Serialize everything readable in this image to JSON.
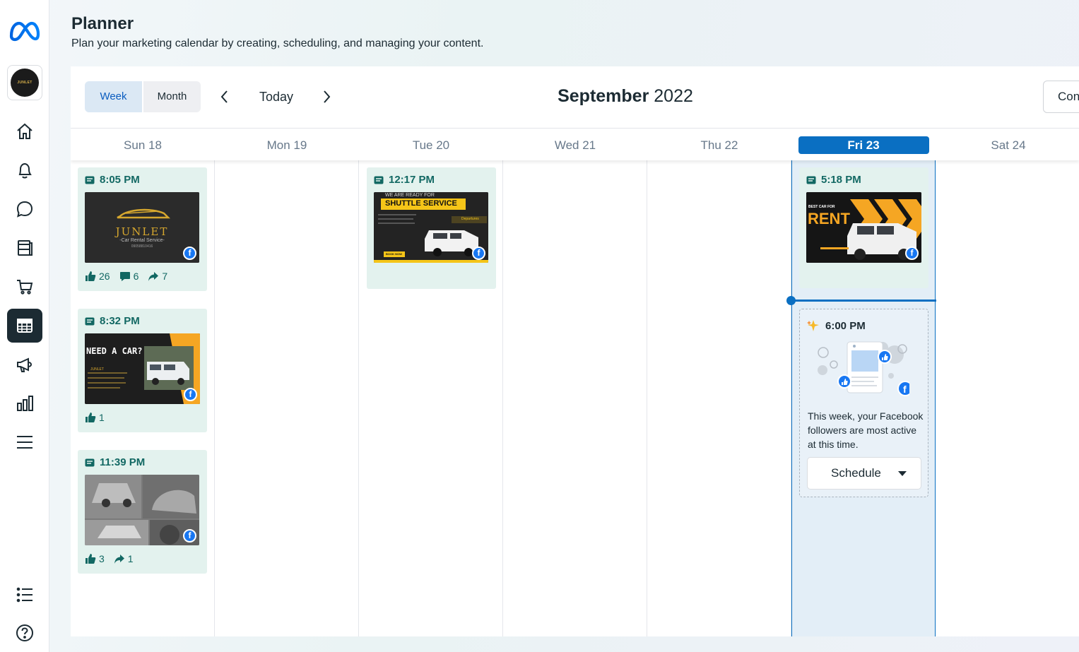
{
  "header": {
    "title": "Planner",
    "subtitle": "Plan your marketing calendar by creating, scheduling, and managing your content."
  },
  "toolbar": {
    "view_week": "Week",
    "view_month": "Month",
    "today_label": "Today",
    "month_bold": "September",
    "year": "2022",
    "right_button_partial": "Con"
  },
  "days": [
    {
      "label": "Sun 18"
    },
    {
      "label": "Mon 19"
    },
    {
      "label": "Tue 20"
    },
    {
      "label": "Wed 21"
    },
    {
      "label": "Thu 22"
    },
    {
      "label": "Fri 23",
      "is_today": true
    },
    {
      "label": "Sat 24"
    }
  ],
  "posts": {
    "sun_1": {
      "time": "8:05 PM",
      "likes": "26",
      "comments": "6",
      "shares": "7",
      "image_text": "JUNLET",
      "image_subtext": "-Car Rental Service-",
      "image_phone": "09058810416"
    },
    "sun_2": {
      "time": "8:32 PM",
      "likes": "1",
      "image_text": "NEED A CAR?",
      "image_subtext": "JUNLET"
    },
    "sun_3": {
      "time": "11:39 PM",
      "likes": "3",
      "shares": "1"
    },
    "tue_1": {
      "time": "12:17 PM",
      "image_text_top": "WE ARE READY FOR",
      "image_text": "SHUTTLE SERVICE",
      "image_subtext": "Departures",
      "image_button": "BOOK NOW"
    },
    "fri_1": {
      "time": "5:18 PM",
      "image_text_top": "BEST CAR FOR",
      "image_text": "RENT"
    }
  },
  "suggestion": {
    "time": "6:00 PM",
    "message": "This week, your Facebook followers are most active at this time.",
    "button_label": "Schedule"
  },
  "sidebar": {
    "avatar_text": "JUNLET",
    "items": [
      "home-icon",
      "notifications-icon",
      "inbox-icon",
      "content-icon",
      "commerce-icon",
      "planner-icon",
      "ads-icon",
      "insights-icon",
      "all-tools-icon"
    ],
    "bottom_items": [
      "edit-list-icon",
      "help-icon"
    ]
  },
  "colors": {
    "accent": "#0a6fc2",
    "post_bg": "#e3f2ee",
    "post_text": "#126863",
    "today_col": "#e3eef7",
    "facebook": "#1877f2"
  }
}
